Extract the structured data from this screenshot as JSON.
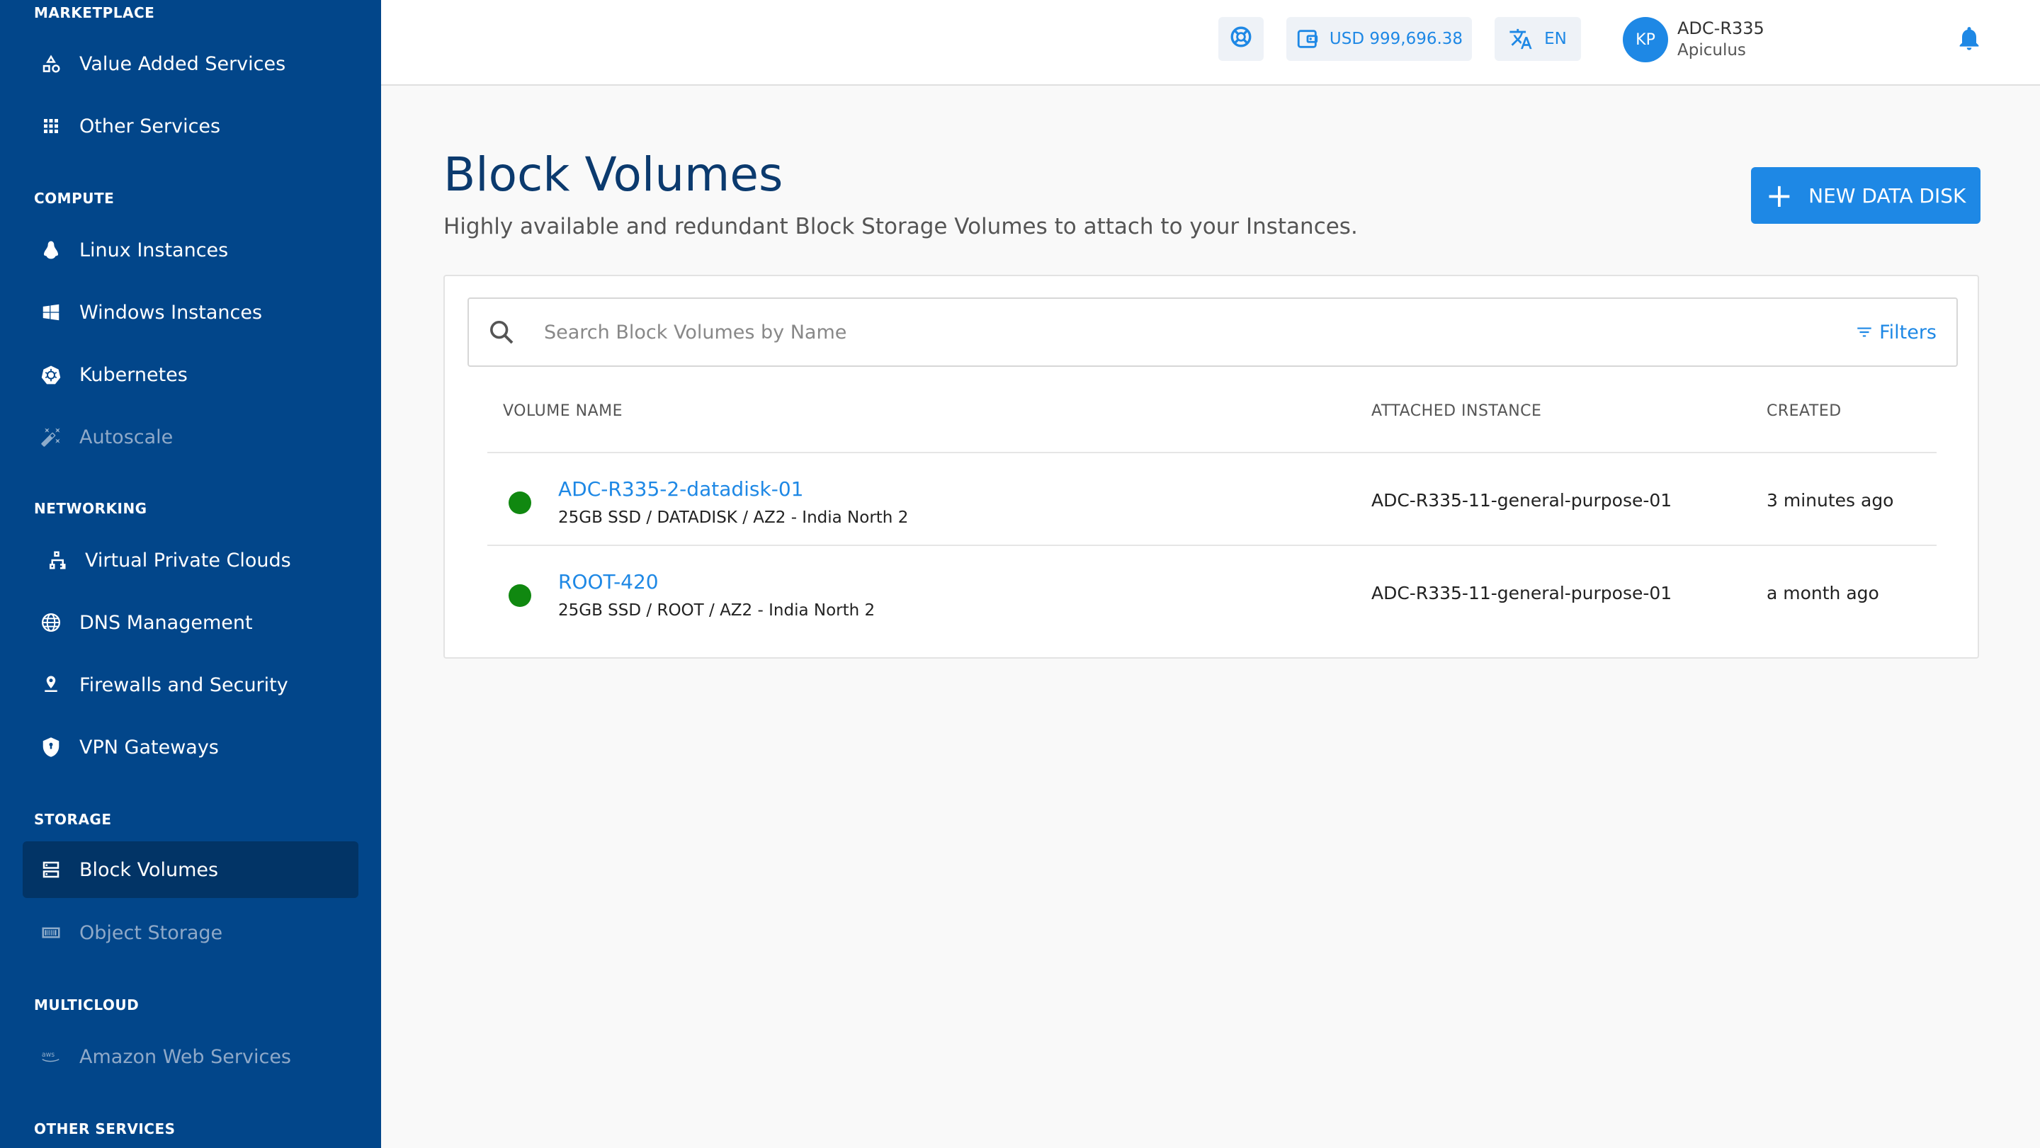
{
  "sidebar": {
    "sections": [
      {
        "label": "MARKETPLACE",
        "items": [
          {
            "label": "Value Added Services",
            "icon": "shapes-icon",
            "disabled": false
          },
          {
            "label": "Other Services",
            "icon": "grid-icon",
            "disabled": false
          }
        ]
      },
      {
        "label": "COMPUTE",
        "items": [
          {
            "label": "Linux Instances",
            "icon": "linux-icon",
            "disabled": false
          },
          {
            "label": "Windows Instances",
            "icon": "windows-icon",
            "disabled": false
          },
          {
            "label": "Kubernetes",
            "icon": "kubernetes-icon",
            "disabled": false
          },
          {
            "label": "Autoscale",
            "icon": "magic-wand-icon",
            "disabled": true
          }
        ]
      },
      {
        "label": "NETWORKING",
        "items": [
          {
            "label": "Virtual Private Clouds",
            "icon": "network-icon",
            "disabled": false
          },
          {
            "label": "DNS Management",
            "icon": "globe-icon",
            "disabled": false
          },
          {
            "label": "Firewalls and Security",
            "icon": "firewall-icon",
            "disabled": false
          },
          {
            "label": "VPN Gateways",
            "icon": "shield-icon",
            "disabled": false
          }
        ]
      },
      {
        "label": "STORAGE",
        "items": [
          {
            "label": "Block Volumes",
            "icon": "storage-icon",
            "disabled": false,
            "active": true
          },
          {
            "label": "Object Storage",
            "icon": "bucket-icon",
            "disabled": true
          }
        ]
      },
      {
        "label": "MULTICLOUD",
        "items": [
          {
            "label": "Amazon Web Services",
            "icon": "aws-icon",
            "disabled": true
          }
        ]
      },
      {
        "label": "OTHER SERVICES",
        "items": []
      }
    ]
  },
  "header": {
    "balance": "USD 999,696.38",
    "language": "EN",
    "avatar_initials": "KP",
    "user_name": "ADC-R335",
    "user_org": "Apiculus"
  },
  "page": {
    "title": "Block Volumes",
    "subtitle": "Highly available and redundant Block Storage Volumes to attach to your Instances.",
    "new_button": "NEW DATA DISK"
  },
  "search": {
    "placeholder": "Search Block Volumes by Name",
    "filters_label": "Filters"
  },
  "table": {
    "columns": {
      "name": "VOLUME NAME",
      "instance": "ATTACHED INSTANCE",
      "created": "CREATED"
    },
    "rows": [
      {
        "name": "ADC-R335-2-datadisk-01",
        "meta": "25GB SSD / DATADISK / AZ2 - India North 2",
        "instance": "ADC-R335-11-general-purpose-01",
        "created": "3 minutes ago",
        "status_color": "#108810"
      },
      {
        "name": "ROOT-420",
        "meta": "25GB SSD / ROOT / AZ2 - India North 2",
        "instance": "ADC-R335-11-general-purpose-01",
        "created": "a month ago",
        "status_color": "#108810"
      }
    ]
  },
  "colors": {
    "sidebar_bg": "#02468a",
    "accent": "#1e88e5",
    "status_active": "#108810"
  }
}
